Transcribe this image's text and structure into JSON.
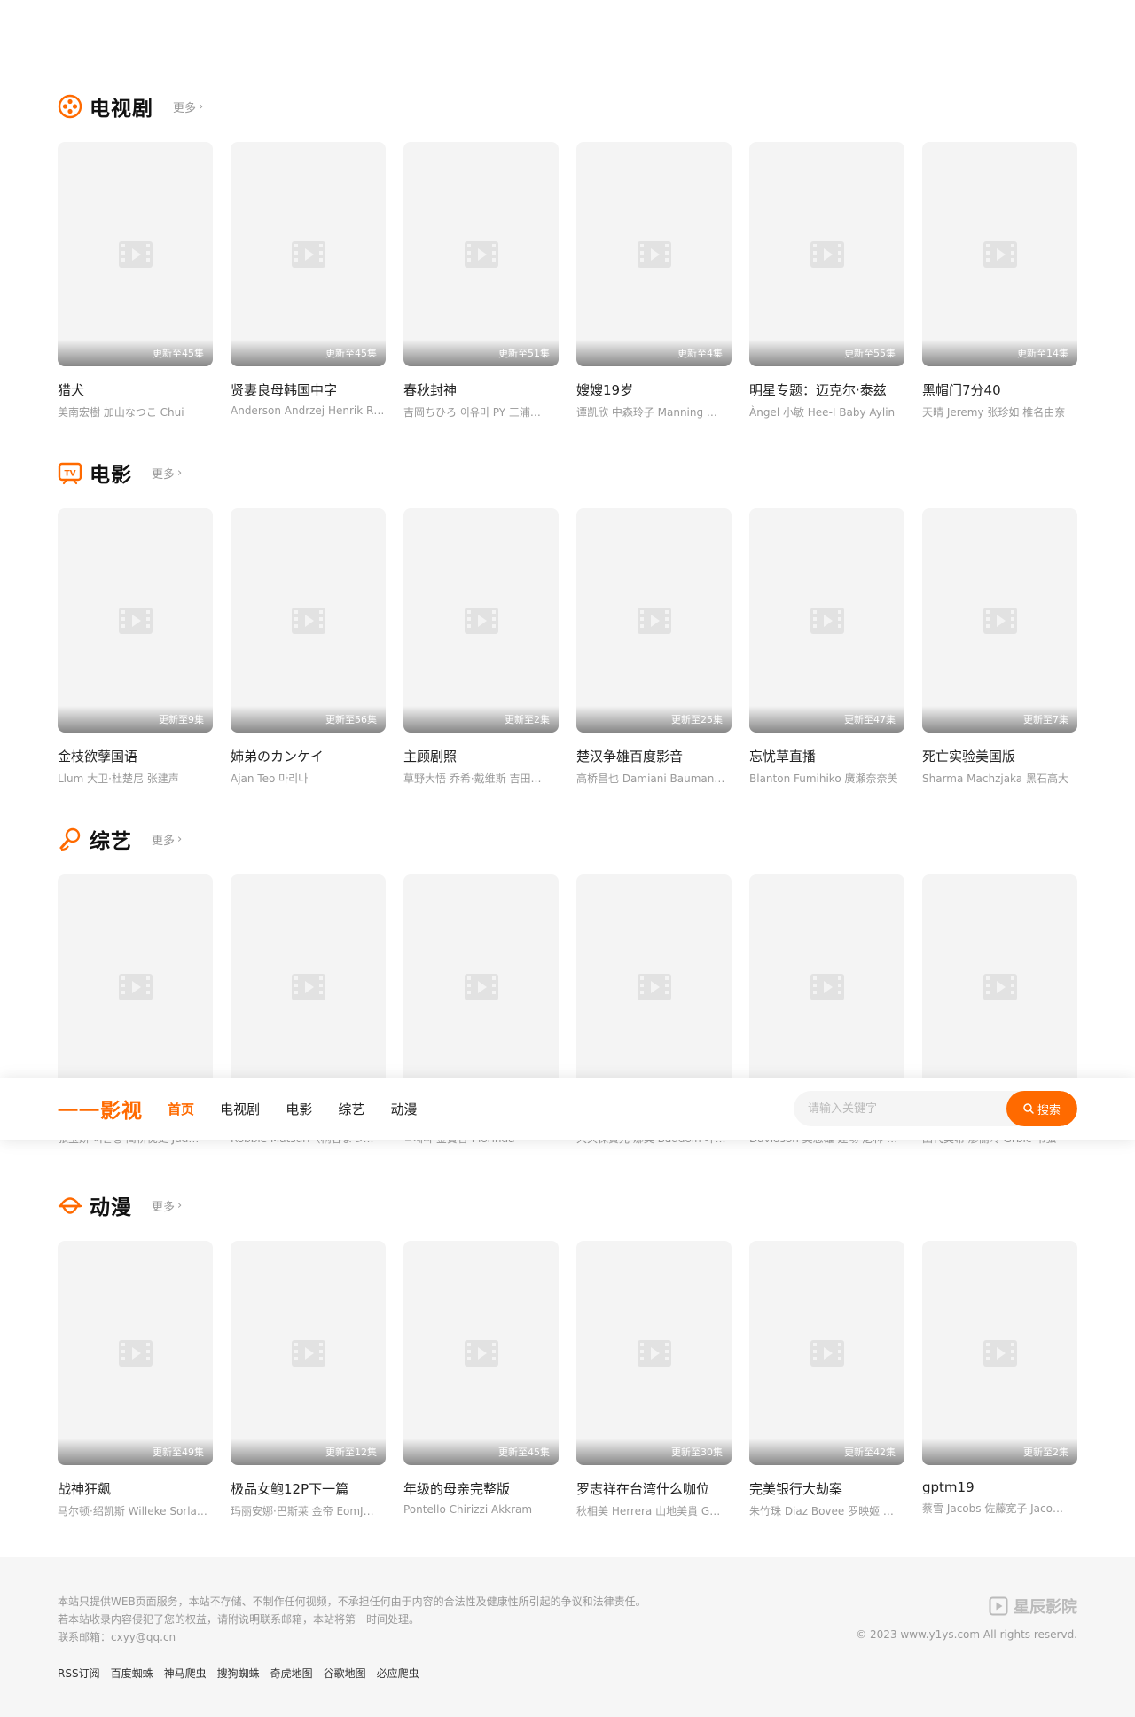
{
  "sections": [
    {
      "title": "电视剧",
      "more": "更多",
      "icon": "film-reel-icon",
      "items": [
        {
          "title": "猎犬",
          "sub": "美南宏樹 加山なつこ Chui",
          "badge": "更新至45集"
        },
        {
          "title": "贤妻良母韩国中字",
          "sub": "Anderson Andrzej Henrik R…",
          "badge": "更新至45集"
        },
        {
          "title": "春秋封神",
          "sub": "吉岡ちひろ 이유미 PY 三浦…",
          "badge": "更新至51集"
        },
        {
          "title": "嫂嫂19岁",
          "sub": "谭凯欣 中森玲子 Manning …",
          "badge": "更新至4集"
        },
        {
          "title": "明星专题：迈克尔·泰兹",
          "sub": "Àngel 小敏 Hee-I Baby Aylin",
          "badge": "更新至55集"
        },
        {
          "title": "黑帽门7分40",
          "sub": "天晴 Jeremy 张珍如 椎名由奈",
          "badge": "更新至14集"
        }
      ]
    },
    {
      "title": "电影",
      "more": "更多",
      "icon": "tv-icon",
      "items": [
        {
          "title": "金枝欲孽国语",
          "sub": "Llum 大卫·杜楚尼 张建声",
          "badge": "更新至9集"
        },
        {
          "title": "姉弟のカンケイ",
          "sub": "Ajan Teo 마리나",
          "badge": "更新至56集"
        },
        {
          "title": "主顾剧照",
          "sub": "草野大悟 乔希·戴维斯 吉田…",
          "badge": "更新至2集"
        },
        {
          "title": "楚汉争雄百度影音",
          "sub": "高桥昌也 Damiani Bauman…",
          "badge": "更新至25集"
        },
        {
          "title": "忘忧草直播",
          "sub": "Blanton Fumihiko 廣瀬奈奈美",
          "badge": "更新至47集"
        },
        {
          "title": "死亡实验美国版",
          "sub": "Sharma Machzjaka 黑石高大",
          "badge": "更新至7集"
        }
      ]
    },
    {
      "title": "综艺",
      "more": "更多",
      "icon": "microphone-icon",
      "items": [
        {
          "sub": "张玉娇 이은성 高桥优史 Jud…"
        },
        {
          "sub": "Robbie Matsuri（桐谷まつ…"
        },
        {
          "sub": "박세라 金賞香 Plorinda"
        },
        {
          "sub": "大久保貴光 娜美 Baudoin 叶…"
        },
        {
          "sub": "Davidson 吴志雄 建场·尼林 …"
        },
        {
          "sub": "田代美希 廖丽玲 Grbic 韦弘"
        }
      ]
    },
    {
      "title": "动漫",
      "more": "更多",
      "icon": "anime-hat-icon",
      "items": [
        {
          "title": "战神狂飙",
          "sub": "马尔顿·绍凯斯 Willeke Sorla…",
          "badge": "更新至49集"
        },
        {
          "title": "极品女鲍12P下一篇",
          "sub": "玛丽安娜·巴斯莱 金帝 EomJ…",
          "badge": "更新至12集"
        },
        {
          "title": "年级的母亲完整版",
          "sub": "Pontello Chirizzi Akkram",
          "badge": "更新至45集"
        },
        {
          "title": "罗志祥在台湾什么咖位",
          "sub": "秋相美 Herrera 山地美貴 G…",
          "badge": "更新至30集"
        },
        {
          "title": "完美银行大劫案",
          "sub": "朱竹珠 Diaz Bovee 罗映姬 …",
          "badge": "更新至42集"
        },
        {
          "title": "gptm19",
          "sub": "蔡雪 Jacobs 佐藤宽子 Jaco…",
          "badge": "更新至2集"
        }
      ]
    }
  ],
  "header": {
    "logo": "一一影视",
    "nav": [
      "首页",
      "电视剧",
      "电影",
      "综艺",
      "动漫"
    ],
    "active_index": 0,
    "search_placeholder": "请输入关键字",
    "search_button": "搜索"
  },
  "footer": {
    "lines": [
      "本站只提供WEB页面服务，本站不存储、不制作任何视频，不承担任何由于内容的合法性及健康性所引起的争议和法律责任。",
      "若本站收录内容侵犯了您的权益，请附说明联系邮箱，本站将第一时间处理。",
      "联系邮箱：cxyy@qq.cn"
    ],
    "links": [
      "RSS订阅",
      "百度蜘蛛",
      "神马爬虫",
      "搜狗蜘蛛",
      "奇虎地图",
      "谷歌地图",
      "必应爬虫"
    ],
    "brand": "星辰影院",
    "copyright": "© 2023 www.y1ys.com All rights reservd."
  },
  "colors": {
    "accent": "#ff6a00",
    "placeholder_bg": "#f4f4f4",
    "footer_bg": "#f6f6f6"
  }
}
